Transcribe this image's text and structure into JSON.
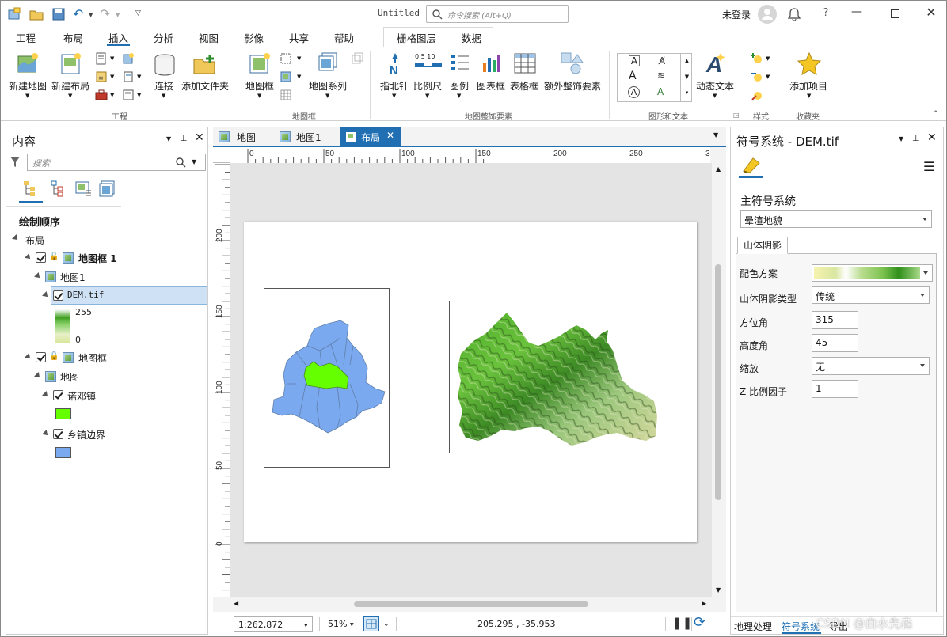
{
  "titlebar": {
    "doc_title": "Untitled",
    "cmd_search_placeholder": "命令搜索 (Alt+Q)",
    "signin": "未登录",
    "help": "?"
  },
  "ribbon_tabs": [
    "工程",
    "布局",
    "插入",
    "分析",
    "视图",
    "影像",
    "共享",
    "帮助"
  ],
  "active_tab": "插入",
  "context_tabs": [
    "栅格图层",
    "数据"
  ],
  "ribbon": {
    "project_group": {
      "label": "工程",
      "new_map": "新建地图",
      "new_layout": "新建布局",
      "connect": "连接",
      "add_folder": "添加文件夹"
    },
    "mapframe_group": {
      "label": "地图框",
      "map_frame": "地图框",
      "map_series": "地图系列"
    },
    "surround_group": {
      "label": "地图整饰要素",
      "north_arrow": "指北针",
      "scale_bar": "比例尺",
      "legend": "图例",
      "chart_frame": "图表框",
      "table_frame": "表格框",
      "extra_elements": "额外整饰要素",
      "scale_ticks": "0 5 10"
    },
    "graphics_group": {
      "label": "图形和文本",
      "dynamic_text": "动态文本"
    },
    "styles_group": {
      "label": "样式"
    },
    "favorites_group": {
      "label": "收藏夹",
      "add_item": "添加项目"
    }
  },
  "contents": {
    "title": "内容",
    "search_placeholder": "搜索",
    "drawing_order": "绘制顺序",
    "root": "布局",
    "mapframe1": "地图框 1",
    "map1": "地图1",
    "dem": "DEM.tif",
    "legend_max": "255",
    "legend_min": "0",
    "mapframe2": "地图框",
    "map": "地图",
    "layer_town": "诺邓镇",
    "layer_border": "乡镇边界"
  },
  "view_tabs": [
    "地图",
    "地图1",
    "布局"
  ],
  "active_view_tab": "布局",
  "ruler_h": [
    "0",
    "50",
    "100",
    "150",
    "200",
    "250",
    "3"
  ],
  "ruler_v": [
    "200",
    "150",
    "100",
    "50",
    "0"
  ],
  "status": {
    "scale": "1:262,872",
    "zoom": "51%",
    "coords": "205.295 , -35.953"
  },
  "symbology": {
    "title": "符号系统 - DEM.tif",
    "primary_label": "主符号系统",
    "primary_value": "晕渲地貌",
    "tab": "山体阴影",
    "color_scheme_label": "配色方案",
    "hillshade_type_label": "山体阴影类型",
    "hillshade_type_value": "传统",
    "azimuth_label": "方位角",
    "azimuth_value": "315",
    "altitude_label": "高度角",
    "altitude_value": "45",
    "resample_label": "缩放",
    "resample_value": "无",
    "zfactor_label": "Z 比例因子",
    "zfactor_value": "1"
  },
  "bottom_tabs": [
    "地理处理",
    "符号系统",
    "导出"
  ],
  "active_bottom_tab": "符号系统",
  "watermark": "CSDN @白水先森",
  "colors": {
    "accent": "#1f6fb2",
    "town_fill": "#66ff00",
    "border_fill": "#7aa9f0"
  }
}
